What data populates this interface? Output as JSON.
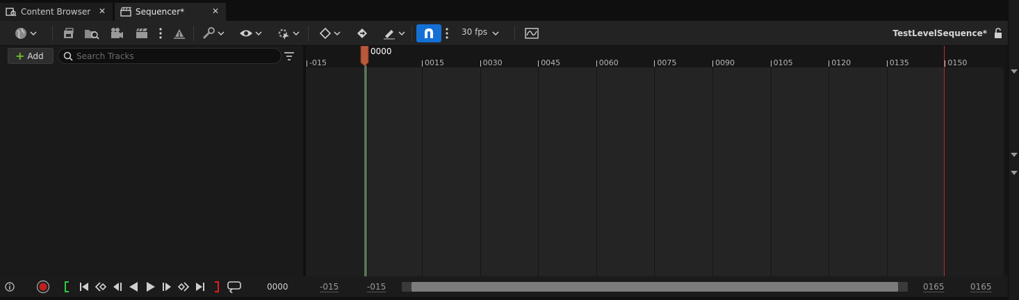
{
  "tabs": [
    {
      "label": "Content Browser",
      "active": false,
      "icon": "content-browser-icon"
    },
    {
      "label": "Sequencer*",
      "active": true,
      "icon": "clapperboard-icon"
    }
  ],
  "toolbar": {
    "fps_label": "30 fps",
    "sequence_name": "TestLevelSequence*",
    "snap_enabled": true,
    "accent_color": "#1570d6",
    "icons": [
      "world-icon",
      "save-icon",
      "find-in-content-browser-icon",
      "render-movie-icon",
      "camera-cut-icon",
      "more-icon",
      "actor-to-sequencer-icon",
      "settings-wrench-icon",
      "visibility-eye-icon",
      "playback-options-icon",
      "key-diamond-icon",
      "key-auto-icon",
      "edit-mode-icon",
      "snap-magnet-icon",
      "curve-editor-icon",
      "lock-icon"
    ]
  },
  "tracks_panel": {
    "add_label": "Add",
    "search_placeholder": "Search Tracks",
    "search_value": ""
  },
  "timeline": {
    "tick_labels": [
      "-015",
      "0015",
      "0030",
      "0045",
      "0060",
      "0075",
      "0090",
      "0105",
      "0120",
      "0135",
      "0150"
    ],
    "playhead_frame": "0000",
    "playback_start_frame": 0,
    "playback_end_frame": 150,
    "start_marker_color": "#3aa83a",
    "end_marker_color": "#c03030",
    "playhead_color": "#b85a3a"
  },
  "transport": {
    "current_frame": "0000",
    "view_start": "-015",
    "work_start": "-015",
    "work_end": "0165",
    "view_end": "0165",
    "icons": [
      "info-icon",
      "record-icon",
      "set-start-bracket-icon",
      "jump-to-start-icon",
      "previous-key-icon",
      "step-back-icon",
      "play-reverse-icon",
      "play-icon",
      "step-forward-icon",
      "next-key-icon",
      "jump-to-end-icon",
      "set-end-bracket-icon",
      "loop-icon"
    ],
    "record_color": "#c02020"
  }
}
